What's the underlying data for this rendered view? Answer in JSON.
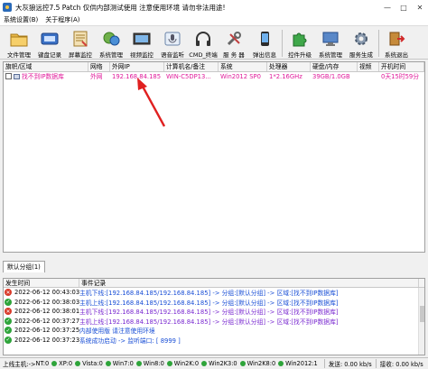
{
  "window": {
    "title": "大灰狼远控7.5 Patch  仅供内部测试使用 注意使用环境  请勿非法用途!"
  },
  "menu": [
    "系统设置(B)",
    "关于程序(A)"
  ],
  "toolbar": [
    {
      "label": "文件管理",
      "icon": "folder-icon"
    },
    {
      "label": "键盘记录",
      "icon": "keyboard-icon"
    },
    {
      "label": "屏幕监控",
      "icon": "screen-monitor-icon"
    },
    {
      "label": "系统管理",
      "icon": "system-manager-icon"
    },
    {
      "label": "视频监控",
      "icon": "video-camera-icon"
    },
    {
      "label": "语音监听",
      "icon": "microphone-icon"
    },
    {
      "label": "CMD_终端",
      "icon": "headphones-icon"
    },
    {
      "label": "服 务 器",
      "icon": "tools-icon"
    },
    {
      "label": "弹出信息",
      "icon": "phone-message-icon"
    },
    {
      "label": "控件升级",
      "icon": "puzzle-icon"
    },
    {
      "label": "系统管理",
      "icon": "monitor-manage-icon"
    },
    {
      "label": "服务生成",
      "icon": "gear-icon"
    },
    {
      "label": "系统退出",
      "icon": "exit-icon"
    }
  ],
  "host_table": {
    "columns": [
      "旗帜/区域",
      "网络",
      "外网IP",
      "计算机名/备注",
      "系统",
      "处理器",
      "硬盘/内存",
      "视频",
      "开机时间"
    ],
    "rows": [
      {
        "region": "找不到IP数据库",
        "network": "外网",
        "ip": "192.168.84.185",
        "computer": "WIN-C5DP13...",
        "os": "Win2012 SP0",
        "cpu": "1*2.16GHz",
        "disk_mem": "39GB/1.0GB",
        "video": "",
        "uptime": "0天15时59分"
      }
    ]
  },
  "tabs": [
    "默认分组(1)"
  ],
  "log": {
    "columns": [
      "发生时间",
      "事件记录"
    ],
    "rows": [
      {
        "status": "error",
        "time": "2022-06-12 00:43:03",
        "event": "主机下线:[192.168.84.185/192.168.84.185] -> 分组:[默认分组] -> 区域:[找不到IP数据库]",
        "kind": "online"
      },
      {
        "status": "ok",
        "time": "2022-06-12 00:38:03",
        "event": "主机上线:[192.168.84.185/192.168.84.185] -> 分组:[默认分组] -> 区域:[找不到IP数据库]",
        "kind": "online"
      },
      {
        "status": "error",
        "time": "2022-06-12 00:38:01",
        "event": "主机下线:[192.168.84.185/192.168.84.185] -> 分组:[默认分组] -> 区域:[找不到IP数据库]",
        "kind": "offline"
      },
      {
        "status": "ok",
        "time": "2022-06-12 00:37:27",
        "event": "主机上线:[192.168.84.185/192.168.84.185] -> 分组:[默认分组] -> 区域:[找不到IP数据库]",
        "kind": "offline"
      },
      {
        "status": "ok",
        "time": "2022-06-12 00:37:25",
        "event": "内部使用版 请注意使用环境",
        "kind": "system"
      },
      {
        "status": "ok",
        "time": "2022-06-12 00:37:23",
        "event": "系统成功启动 -> 监听端口: [ 8999 ]",
        "kind": "system"
      }
    ]
  },
  "statusbar": {
    "prefix": "上线主机:->",
    "systems": [
      "NT:0",
      "XP:0",
      "Vista:0",
      "Win7:0",
      "Win8:0",
      "Win2K:0",
      "Win2K3:0",
      "Win2K8:0",
      "Win2012:1"
    ],
    "send": "发送: 0.00 kb/s",
    "recv": "接收: 0.00 kb/s"
  },
  "colors": {
    "host_row": "#e01a9a",
    "log_online": "#1a4fd6",
    "log_offline": "#7a2ad0",
    "annotation_arrow": "#e02020"
  }
}
